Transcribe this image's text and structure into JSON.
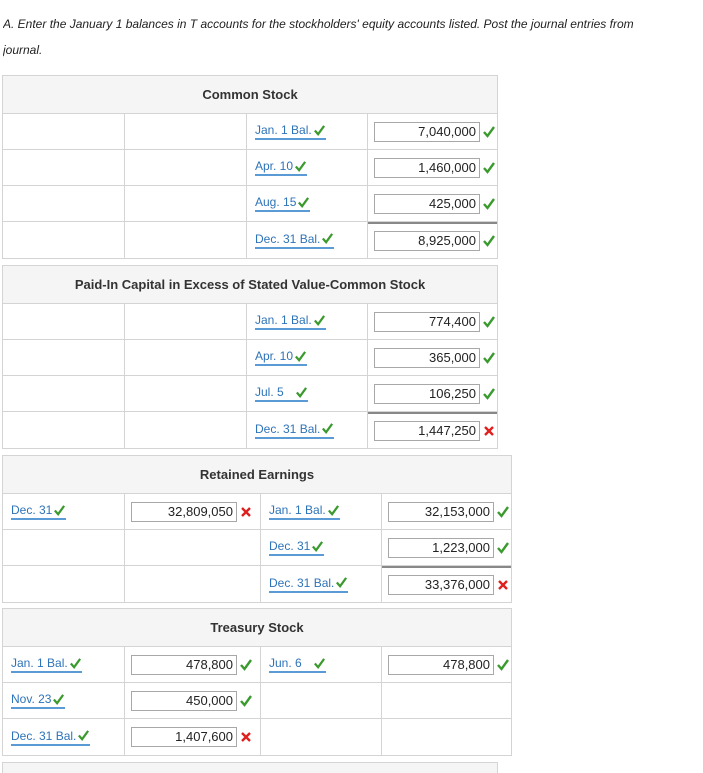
{
  "instruction": {
    "line1": "A. Enter the January 1 balances in T accounts for the stockholders' equity accounts listed. Post the journal entries from",
    "line2": "journal."
  },
  "colors": {
    "check": "#3a9a2e",
    "cross": "#e0201e",
    "label": "#2e73b8",
    "underline": "#5b9bd5"
  },
  "accounts": [
    {
      "title": "Common Stock",
      "rows": [
        {
          "debit_label": "",
          "debit_value": "",
          "credit_label": "Jan. 1 Bal.",
          "credit_value": "7,040,000",
          "credit_status": "check"
        },
        {
          "debit_label": "",
          "debit_value": "",
          "credit_label": "Apr. 10",
          "credit_value": "1,460,000",
          "credit_status": "check"
        },
        {
          "debit_label": "",
          "debit_value": "",
          "credit_label": "Aug. 15",
          "credit_value": "425,000",
          "credit_status": "check"
        },
        {
          "debit_label": "",
          "debit_value": "",
          "credit_label": "Dec. 31 Bal.",
          "credit_value": "8,925,000",
          "credit_status": "check"
        }
      ]
    },
    {
      "title": "Paid-In Capital in Excess of Stated Value-Common Stock",
      "rows": [
        {
          "credit_label": "Jan. 1 Bal.",
          "credit_value": "774,400",
          "credit_status": "check"
        },
        {
          "credit_label": "Apr. 10",
          "credit_value": "365,000",
          "credit_status": "check"
        },
        {
          "credit_label": "Jul. 5",
          "credit_value": "106,250",
          "credit_status": "check"
        },
        {
          "credit_label": "Dec. 31 Bal.",
          "credit_value": "1,447,250",
          "credit_status": "cross"
        }
      ]
    },
    {
      "title": "Retained Earnings",
      "rows": [
        {
          "debit_label": "Dec. 31",
          "debit_value": "32,809,050",
          "debit_status": "cross",
          "credit_label": "Jan. 1 Bal.",
          "credit_value": "32,153,000",
          "credit_status": "check"
        },
        {
          "credit_label": "Dec. 31",
          "credit_value": "1,223,000",
          "credit_status": "check"
        },
        {
          "credit_label": "Dec. 31 Bal.",
          "credit_value": "33,376,000",
          "credit_status": "cross"
        }
      ]
    },
    {
      "title": "Treasury Stock",
      "rows": [
        {
          "debit_label": "Jan. 1 Bal.",
          "debit_value": "478,800",
          "debit_status": "check",
          "credit_label": "Jun. 6",
          "credit_value": "478,800",
          "credit_status": "check"
        },
        {
          "debit_label": "Nov. 23",
          "debit_value": "450,000",
          "debit_status": "check"
        },
        {
          "debit_label": "Dec. 31 Bal.",
          "debit_value": "1,407,600",
          "debit_status": "cross"
        }
      ]
    }
  ]
}
